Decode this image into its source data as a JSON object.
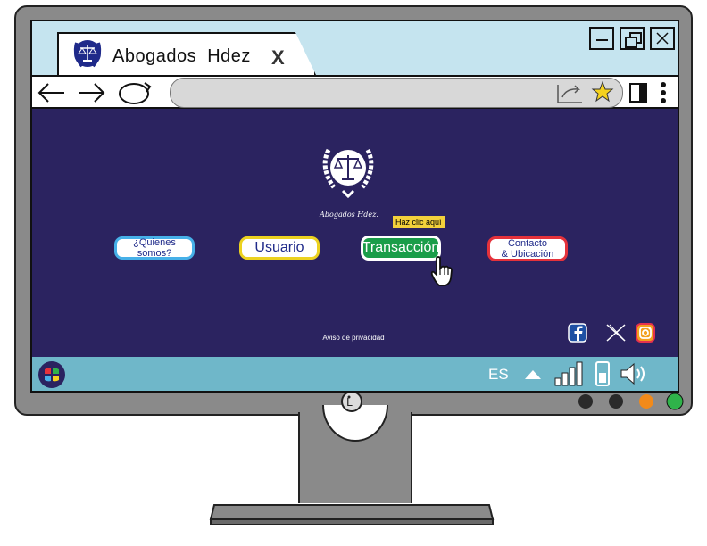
{
  "browser": {
    "tab_title": "Abogados  Hdez",
    "tab_close_glyph": "X",
    "window_buttons": [
      "minimize-icon",
      "restore-icon",
      "close-icon"
    ],
    "nav_icons": [
      "back-arrow-icon",
      "forward-arrow-icon",
      "reload-icon",
      "share-icon",
      "star-icon",
      "sidebar-icon",
      "kebab-menu-icon"
    ]
  },
  "logo": {
    "caption": "Abogados Hdez."
  },
  "nav": {
    "quienes": "¿Quienes somos?",
    "usuario": "Usuario",
    "transaccion": "Transacción",
    "contacto_line1": "Contacto",
    "contacto_line2": "& Ubicación"
  },
  "tooltip": "Haz clic aquí",
  "footer": {
    "privacy": "Aviso de privacidad",
    "social_icons": [
      "facebook-icon",
      "x-icon",
      "instagram-icon"
    ]
  },
  "taskbar": {
    "language": "ES",
    "tray_icons": [
      "up-arrow-icon",
      "signal-icon",
      "battery-icon",
      "volume-icon"
    ]
  },
  "colors": {
    "page_bg": "#2b2360",
    "chrome_bg": "#c5e4ef",
    "taskbar_bg": "#6fb7c9",
    "transaccion_green": "#1a9d49",
    "tooltip_yellow": "#f3d13b"
  }
}
